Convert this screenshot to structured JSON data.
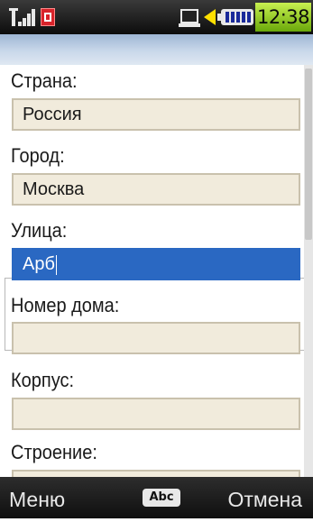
{
  "status_bar": {
    "icons": [
      "signal-icon",
      "message-icon",
      "network-icon",
      "speaker-icon",
      "battery-icon"
    ],
    "time": "12:38",
    "colors": {
      "clock_bg": "#9ed02a",
      "speaker": "#ffe000",
      "message": "#d8232a"
    }
  },
  "form": {
    "fields": [
      {
        "label": "Страна:",
        "value": "Россия"
      },
      {
        "label": "Город:",
        "value": "Москва"
      },
      {
        "label": "Улица:",
        "value": "Арб"
      },
      {
        "label": "Номер дома:",
        "value": ""
      },
      {
        "label": "Корпус:",
        "value": ""
      },
      {
        "label": "Строение:",
        "value": ""
      }
    ],
    "active_index": 2,
    "colors": {
      "field_bg": "#f1ebdc",
      "active_bg": "#2a68c2"
    }
  },
  "softkeys": {
    "left": "Меню",
    "input_mode": "Abc",
    "right": "Отмена"
  }
}
